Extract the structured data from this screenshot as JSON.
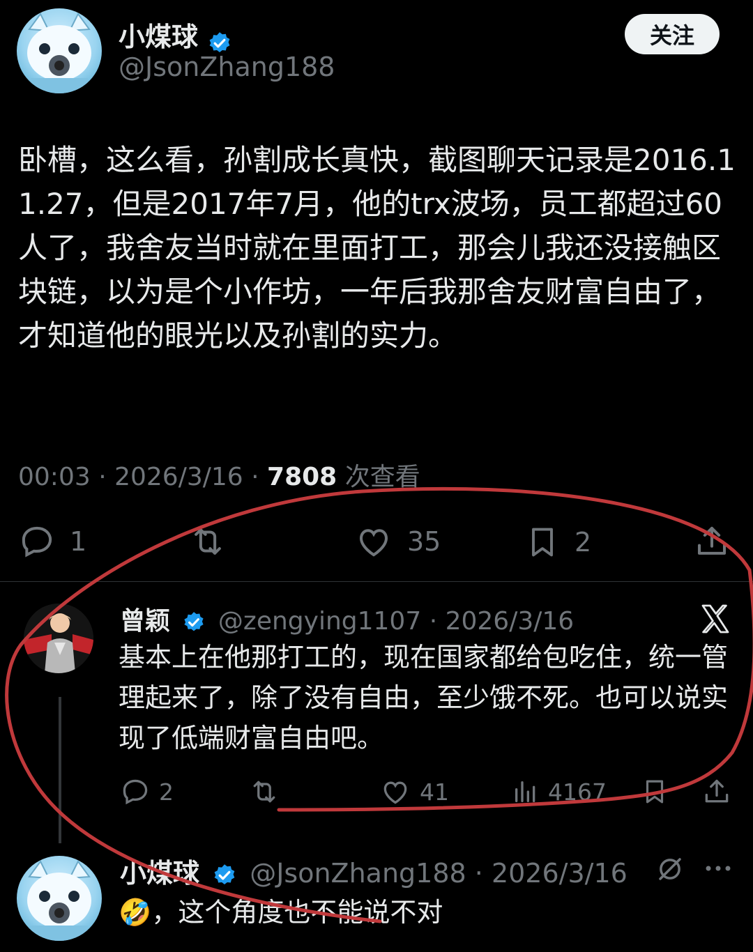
{
  "main_post": {
    "author_name": "小煤球",
    "handle": "@JsonZhang188",
    "follow_label": "关注",
    "body": "卧槽，这么看，孙割成长真快，截图聊天记录是2016.11.27，但是2017年7月，他的trx波场，员工都超过60人了，我舍友当时就在里面打工，那会儿我还没接触区块链，以为是个小作坊，一年后我那舍友财富自由了，才知道他的眼光以及孙割的实力。",
    "time": "00:03",
    "date": "2026/3/16",
    "views_count": "7808",
    "views_label": "次查看",
    "replies": "1",
    "likes": "35",
    "bookmarks": "2"
  },
  "reply": {
    "author_name": "曾颖",
    "handle": "@zengying1107",
    "date": "2026/3/16",
    "body": "基本上在他那打工的，现在国家都给包吃住，统一管理起来了，除了没有自由，至少饿不死。也可以说实现了低端财富自由吧。",
    "replies": "2",
    "likes": "41",
    "views": "4167"
  },
  "reply2": {
    "author_name": "小煤球",
    "handle": "@JsonZhang188",
    "date": "2026/3/16",
    "body": "🤣，这个角度也不能说不对"
  },
  "colors": {
    "background": "#000000",
    "text": "#e7e9ea",
    "muted": "#71767b",
    "verified": "#1d9bf0",
    "annotation": "#c0393b"
  }
}
